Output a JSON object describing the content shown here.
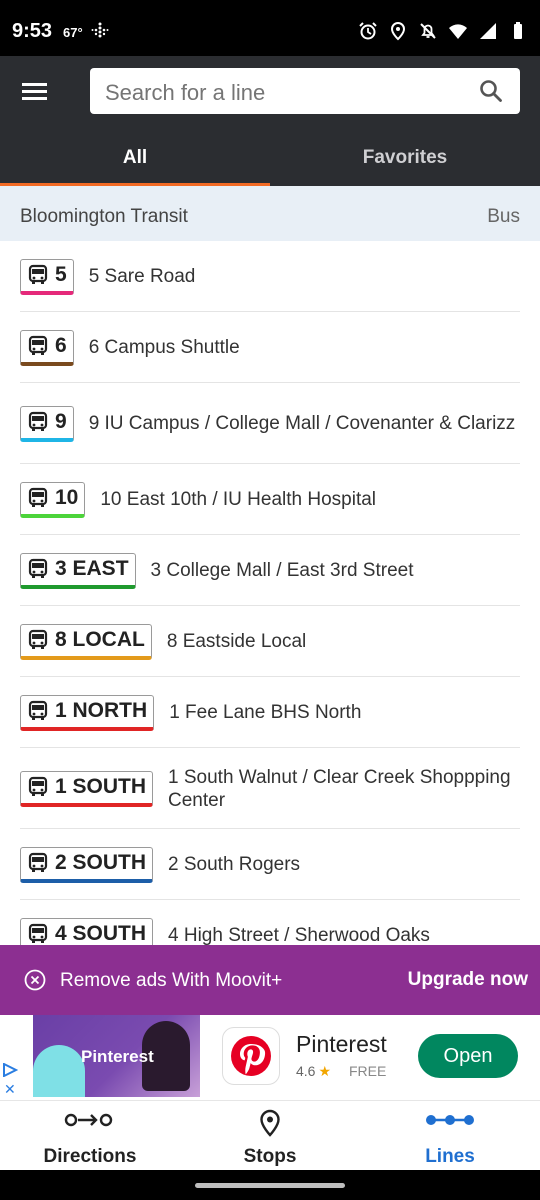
{
  "status_bar": {
    "time": "9:53",
    "temperature": "67°",
    "icons": [
      "alarm-icon",
      "location-icon",
      "notifications-off-icon",
      "wifi-icon",
      "signal-icon",
      "battery-icon"
    ]
  },
  "search": {
    "placeholder": "Search for a line"
  },
  "tabs": [
    {
      "label": "All",
      "selected": true
    },
    {
      "label": "Favorites",
      "selected": false
    }
  ],
  "agency": {
    "name": "Bloomington Transit",
    "type": "Bus"
  },
  "lines": [
    {
      "badge": "5",
      "name": "5 Sare Road",
      "color": "#e5297a"
    },
    {
      "badge": "6",
      "name": "6 Campus Shuttle",
      "color": "#7a4a1e"
    },
    {
      "badge": "9",
      "name": "9 IU Campus / College Mall / Covenanter & Clarizz",
      "color": "#1fb5e6"
    },
    {
      "badge": "10",
      "name": "10 East 10th / IU Health Hospital",
      "color": "#4cd43a"
    },
    {
      "badge": "3 EAST",
      "name": "3 College Mall / East 3rd Street",
      "color": "#1f9a2e"
    },
    {
      "badge": "8 LOCAL",
      "name": "8 Eastside Local",
      "color": "#e39a1b"
    },
    {
      "badge": "1 NORTH",
      "name": "1 Fee Lane BHS North",
      "color": "#e02525"
    },
    {
      "badge": "1 SOUTH",
      "name": "1 South Walnut / Clear Creek Shoppping Center",
      "color": "#e02525"
    },
    {
      "badge": "2 SOUTH",
      "name": "2 South Rogers",
      "color": "#1d5ea8"
    },
    {
      "badge": "4 SOUTH",
      "name": "4 High Street / Sherwood Oaks",
      "color": "#888888"
    }
  ],
  "ad_banner": {
    "text": "Remove ads With Moovit+",
    "action": "Upgrade now"
  },
  "ad": {
    "image_text": "Pinterest",
    "app_name": "Pinterest",
    "rating": "4.6",
    "price": "FREE",
    "button": "Open"
  },
  "bottom_nav": [
    {
      "label": "Directions",
      "icon": "directions-icon",
      "active": false
    },
    {
      "label": "Stops",
      "icon": "stops-icon",
      "active": false
    },
    {
      "label": "Lines",
      "icon": "lines-icon",
      "active": true
    }
  ],
  "colors": {
    "accent": "#f26a24",
    "appbar": "#2b2d31",
    "ad_banner": "#8c2f91",
    "active_nav": "#1f6fd0"
  }
}
